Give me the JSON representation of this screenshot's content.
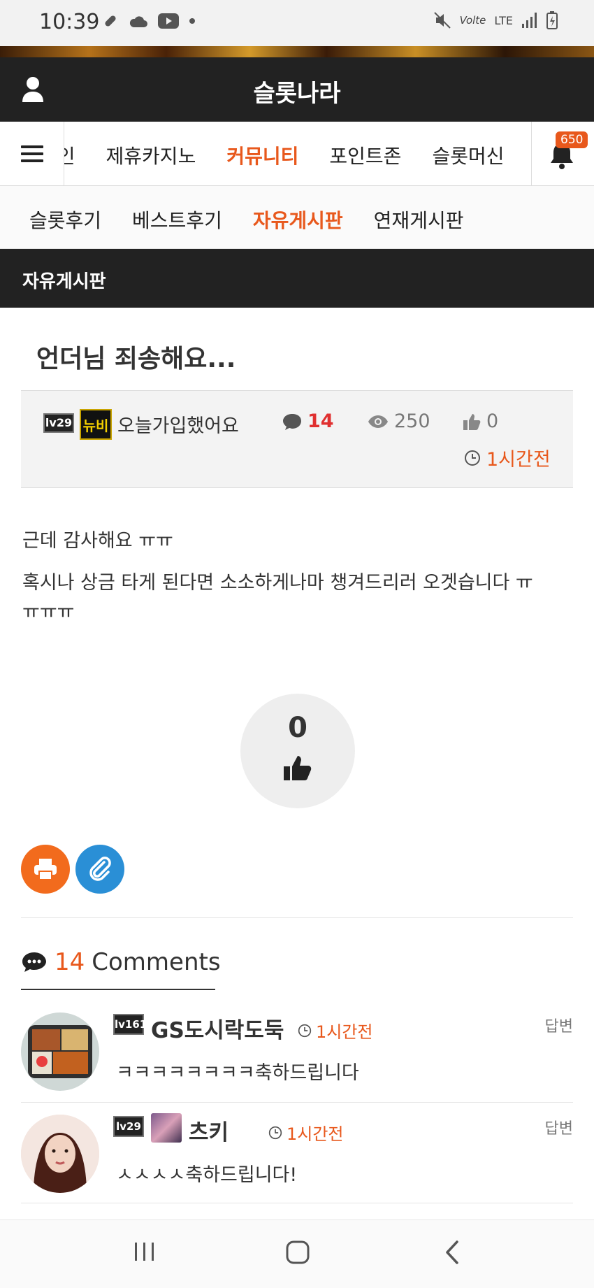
{
  "status_bar": {
    "time": "10:39",
    "network": "LTE"
  },
  "header": {
    "site_title": "슬롯나라"
  },
  "main_nav": {
    "tabs": [
      "메인",
      "제휴카지노",
      "커뮤니티",
      "포인트존",
      "슬롯머신"
    ],
    "active": "커뮤니티",
    "notification_count": "650"
  },
  "sub_nav": {
    "tabs": [
      "슬롯후기",
      "베스트후기",
      "자유게시판",
      "연재게시판"
    ],
    "active": "자유게시판"
  },
  "board": {
    "title": "자유게시판"
  },
  "post": {
    "title": "언더님 죄송해요...",
    "author_level": "lv29",
    "author_badge": "뉴비",
    "author": "오늘가입했어요",
    "comment_count": "14",
    "view_count": "250",
    "like_count": "0",
    "time": "1시간전",
    "body": [
      "근데 감사해요 ㅠㅠ",
      "혹시나 상금 타게 된다면 소소하게나마 챙겨드리러 오겟습니다 ㅠ",
      "ㅠㅠㅠ"
    ],
    "recommend_count": "0"
  },
  "comments_section": {
    "count": "14",
    "label": "Comments",
    "items": [
      {
        "level": "lv161",
        "name": "GS도시락도둑",
        "time": "1시간전",
        "text": "ㅋㅋㅋㅋㅋㅋㅋㅋ축하드립니다",
        "reply": "답변"
      },
      {
        "level": "lv29",
        "name": "츠키",
        "time": "1시간전",
        "text": "ㅅㅅㅅㅅ축하드립니다!",
        "reply": "답변"
      }
    ]
  },
  "colors": {
    "accent": "#e8581c",
    "header_bg": "#222222",
    "print_btn": "#f26b1d",
    "link_btn": "#2a8fd6",
    "comment_count": "#e03030"
  },
  "icons": [
    "user-icon",
    "menu-icon",
    "bell-icon",
    "comment-icon",
    "eye-icon",
    "thumbs-up-icon",
    "clock-icon",
    "print-icon",
    "paperclip-icon"
  ]
}
